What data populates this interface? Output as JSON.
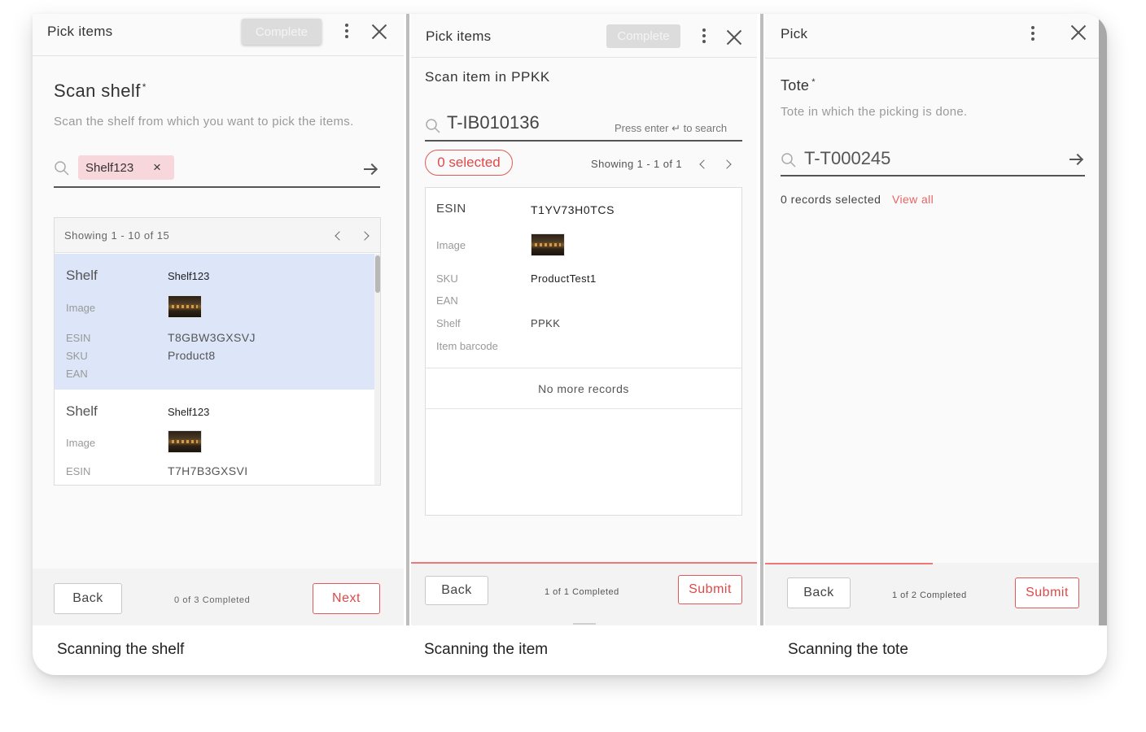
{
  "panel1": {
    "title": "Pick items",
    "complete_label": "Complete",
    "heading": "Scan shelf",
    "required_mark": "*",
    "description": "Scan the shelf from which you want to pick the items.",
    "chip_value": "Shelf123",
    "chip_remove": "×",
    "showing": "Showing 1 - 10 of 15",
    "records": [
      {
        "shelf_label": "Shelf",
        "shelf_value": "Shelf123",
        "image_label": "Image",
        "esin_label": "ESIN",
        "esin_value": "T8GBW3GXSVJ",
        "sku_label": "SKU",
        "sku_value": "Product8",
        "ean_label": "EAN"
      },
      {
        "shelf_label": "Shelf",
        "shelf_value": "Shelf123",
        "image_label": "Image",
        "esin_label": "ESIN",
        "esin_value": "T7H7B3GXSVI"
      }
    ],
    "back_label": "Back",
    "progress_text": "0 of 3 Completed",
    "next_label": "Next",
    "caption": "Scanning the shelf"
  },
  "panel2": {
    "title": "Pick items",
    "complete_label": "Complete",
    "subtitle": "Scan item in PPKK",
    "search_value": "T-IB010136",
    "search_hint": "Press enter ↵ to search",
    "selected_badge": "0 selected",
    "showing": "Showing 1 - 1 of 1",
    "record": {
      "esin_label": "ESIN",
      "esin_value": "T1YV73H0TCS",
      "image_label": "Image",
      "sku_label": "SKU",
      "sku_value": "ProductTest1",
      "ean_label": "EAN",
      "shelf_label": "Shelf",
      "shelf_value": "PPKK",
      "barcode_label": "Item barcode"
    },
    "no_more": "No more records",
    "back_label": "Back",
    "progress_text": "1 of 1 Completed",
    "submit_label": "Submit",
    "caption": "Scanning the item"
  },
  "panel3": {
    "title": "Pick",
    "heading": "Tote",
    "required_mark": "*",
    "description": "Tote in which the picking is done.",
    "search_value": "T-T000245",
    "records_selected": "0 records selected",
    "view_all": "View all",
    "back_label": "Back",
    "progress_text": "1 of 2 Completed",
    "submit_label": "Submit",
    "caption": "Scanning the tote"
  },
  "colors": {
    "accent_red": "#e04848",
    "selected_row": "#dce6f8",
    "chip_bg": "#f8d7dc"
  },
  "progress": {
    "panel2_fraction": 1.0,
    "panel3_fraction": 0.5
  }
}
